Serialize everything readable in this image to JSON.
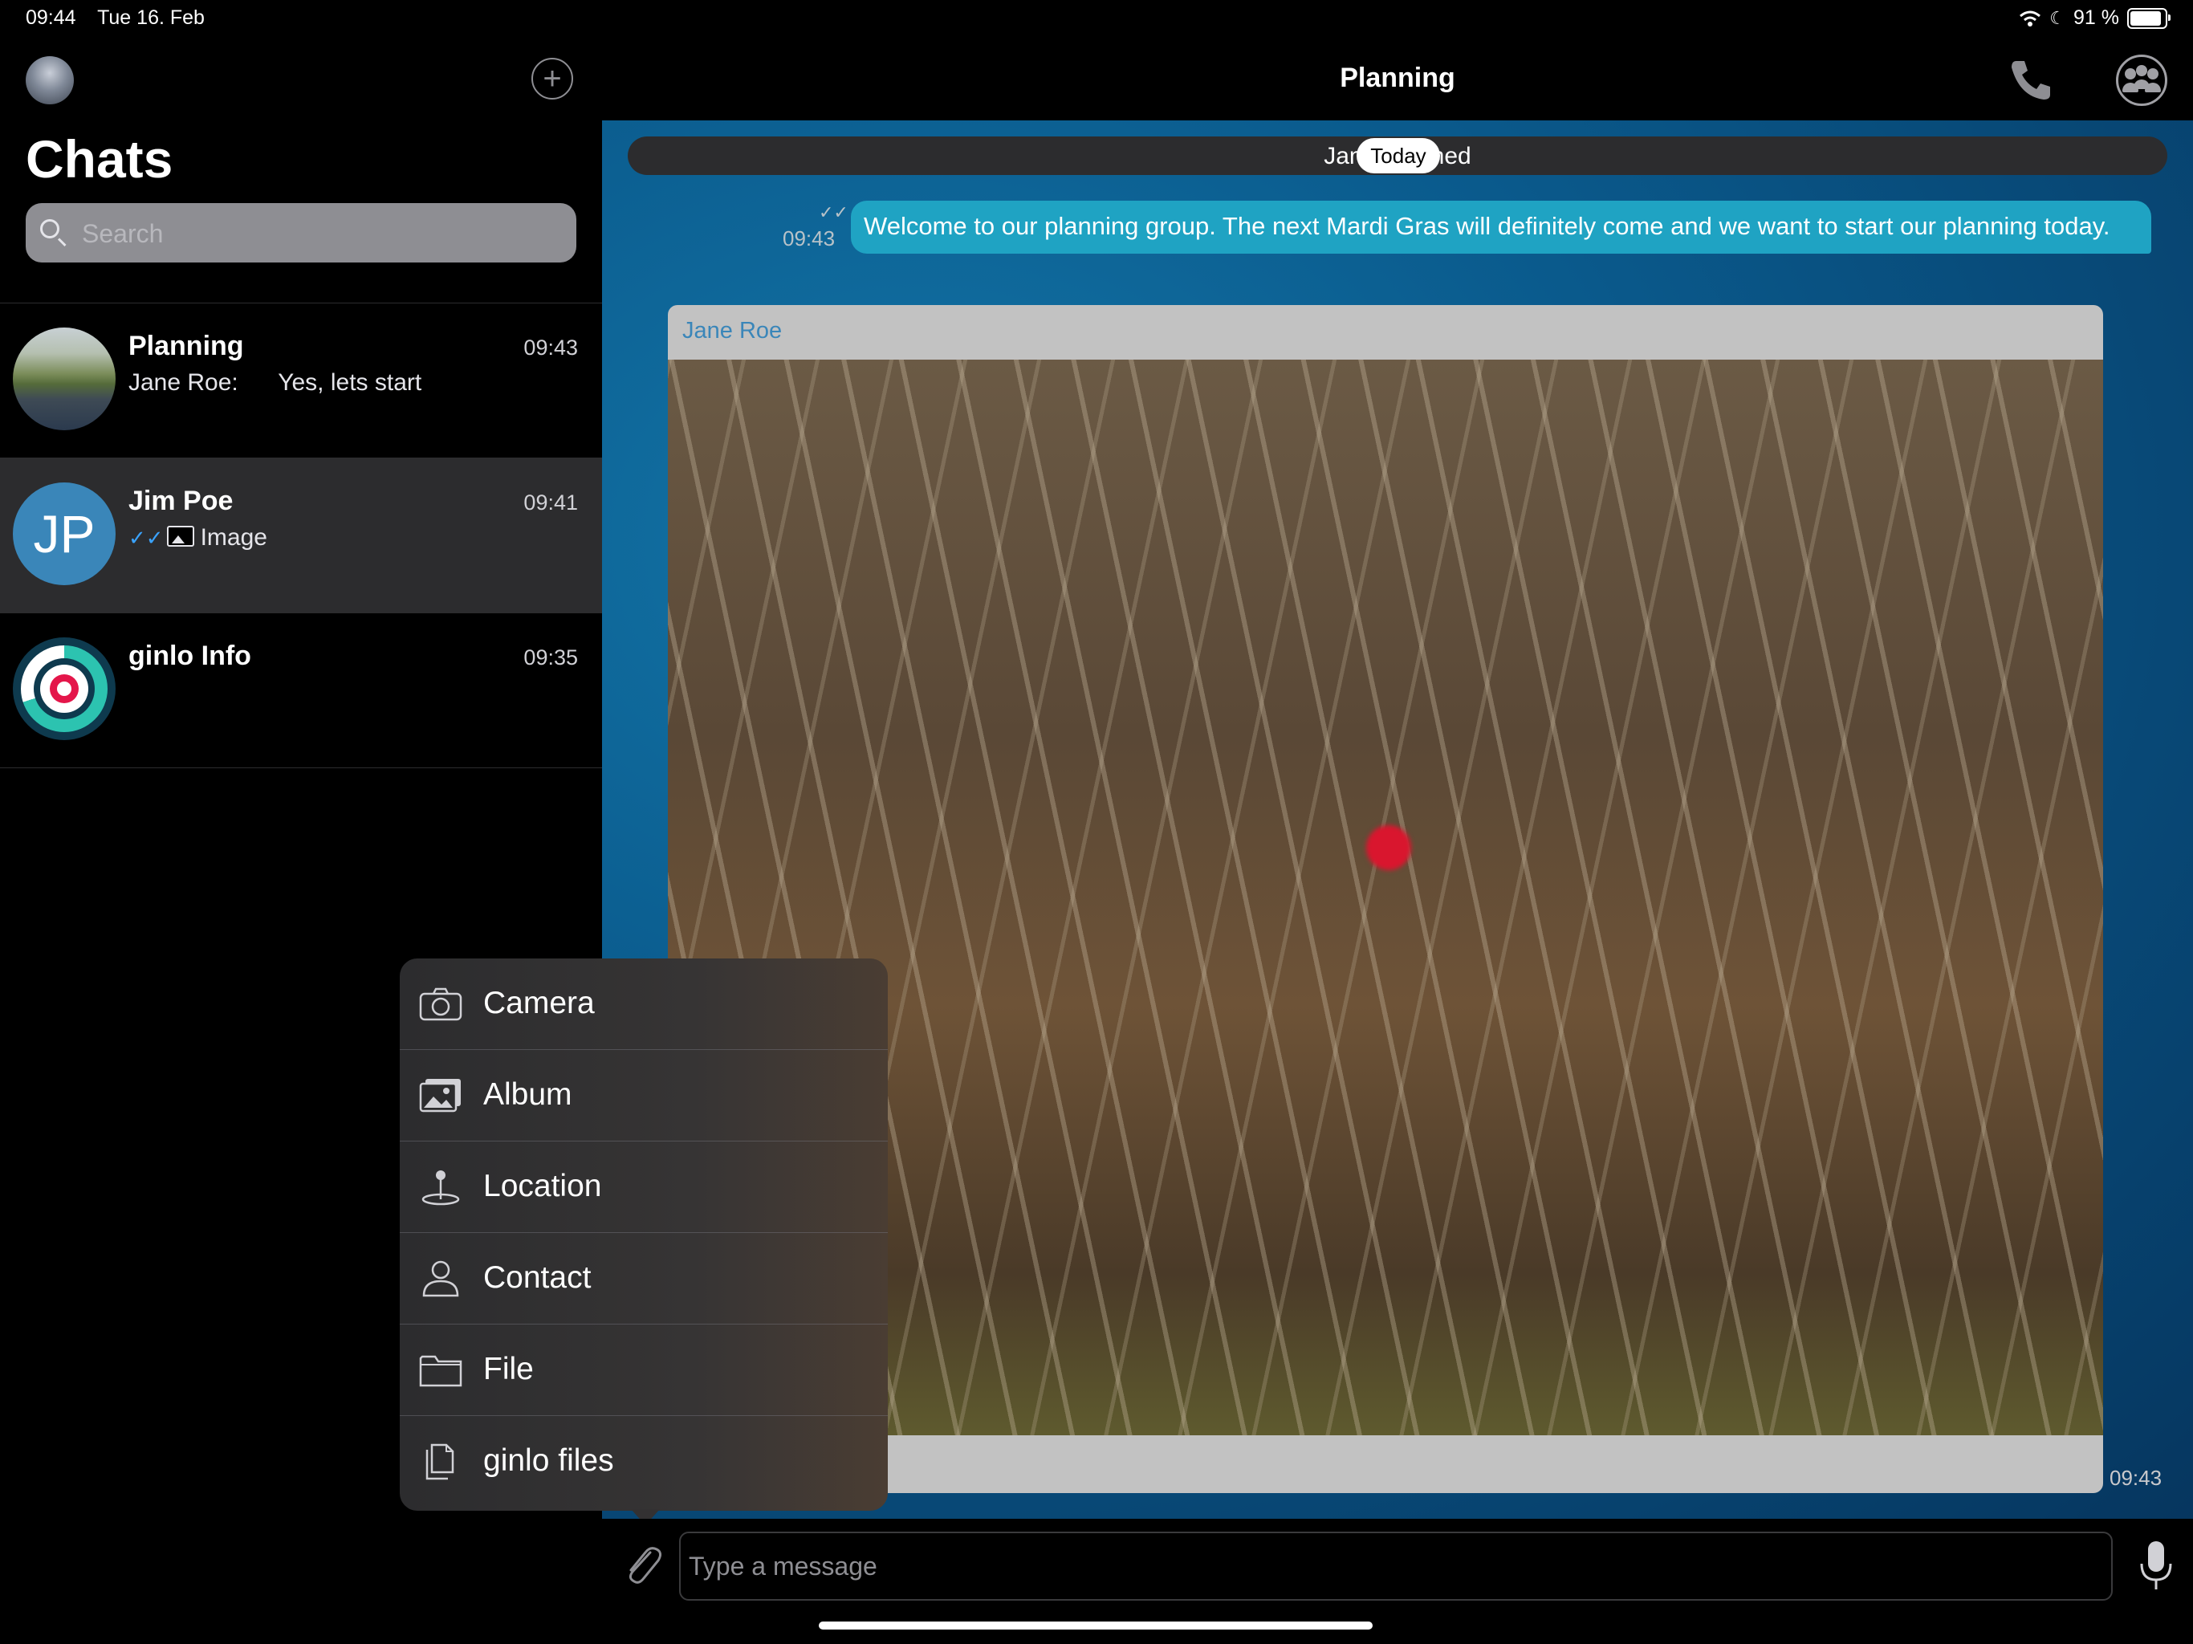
{
  "status_bar": {
    "time": "09:44",
    "date": "Tue 16. Feb",
    "battery": "91 %",
    "battery_level": 0.91
  },
  "sidebar": {
    "title": "Chats",
    "search_placeholder": "Search",
    "chats": [
      {
        "name": "Planning",
        "time": "09:43",
        "preview_sender": "Jane Roe:",
        "preview_text": "Yes, lets start"
      },
      {
        "name": "Jim Poe",
        "time": "09:41",
        "avatar_initials": "JP",
        "preview_text": "Image",
        "selected": true
      },
      {
        "name": "ginlo Info",
        "time": "09:35"
      }
    ]
  },
  "conversation": {
    "title": "Planning",
    "system_message": "Jane R",
    "system_message_suffix": "joined",
    "date_badge": "Today",
    "outgoing_message": {
      "text": "Welcome to our planning group. The next Mardi Gras will definitely come and we want to start our planning today.",
      "time": "09:43"
    },
    "image_message": {
      "sender": "Jane Roe",
      "time": "09:43"
    }
  },
  "attach_menu": {
    "items": [
      {
        "label": "Camera",
        "icon": "camera-icon"
      },
      {
        "label": "Album",
        "icon": "album-icon"
      },
      {
        "label": "Location",
        "icon": "location-icon"
      },
      {
        "label": "Contact",
        "icon": "contact-icon"
      },
      {
        "label": "File",
        "icon": "folder-icon"
      },
      {
        "label": "ginlo files",
        "icon": "files-icon"
      }
    ]
  },
  "composer": {
    "placeholder": "Type a message"
  },
  "colors": {
    "accent": "#3a86b9",
    "bubble_out": "#1fa3c3",
    "chat_background": "#0a5a8e",
    "brand_red": "#e4164a",
    "brand_teal": "#2cc3b0"
  }
}
